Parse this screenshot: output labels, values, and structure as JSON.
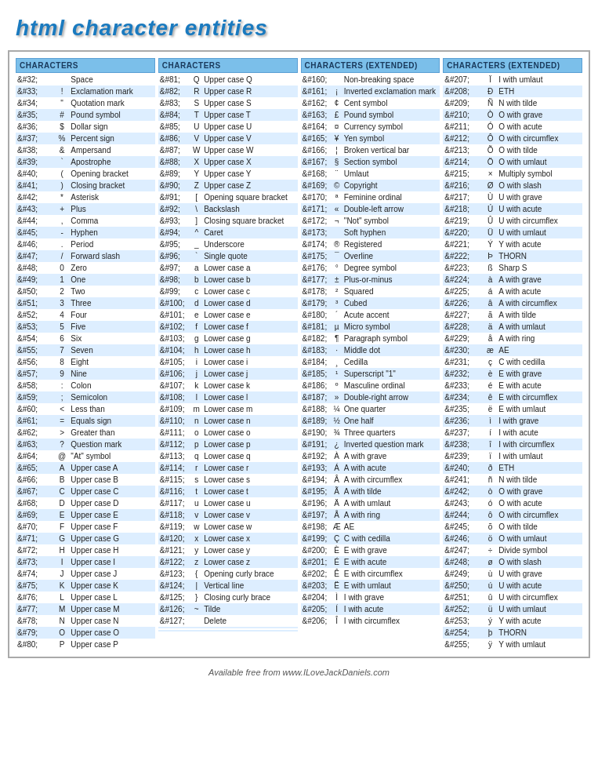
{
  "title": "html character entities",
  "footer": "Available free from www.ILoveJackDaniels.com",
  "columns": [
    {
      "header": "CHARACTERS",
      "rows": [
        [
          "&#32;",
          " ",
          "Space"
        ],
        [
          "&#33;",
          "!",
          "Exclamation mark"
        ],
        [
          "&#34;",
          "\"",
          "Quotation mark"
        ],
        [
          "&#35;",
          "#",
          "Pound symbol"
        ],
        [
          "&#36;",
          "$",
          "Dollar sign"
        ],
        [
          "&#37;",
          "%",
          "Percent sign"
        ],
        [
          "&#38;",
          "&",
          "Ampersand"
        ],
        [
          "&#39;",
          "`",
          "Apostrophe"
        ],
        [
          "&#40;",
          "(",
          "Opening bracket"
        ],
        [
          "&#41;",
          ")",
          "Closing bracket"
        ],
        [
          "&#42;",
          "*",
          "Asterisk"
        ],
        [
          "&#43;",
          "+",
          "Plus"
        ],
        [
          "&#44;",
          ",",
          "Comma"
        ],
        [
          "&#45;",
          "-",
          "Hyphen"
        ],
        [
          "&#46;",
          ".",
          "Period"
        ],
        [
          "&#47;",
          "/",
          "Forward slash"
        ],
        [
          "&#48;",
          "0",
          "Zero"
        ],
        [
          "&#49;",
          "1",
          "One"
        ],
        [
          "&#50;",
          "2",
          "Two"
        ],
        [
          "&#51;",
          "3",
          "Three"
        ],
        [
          "&#52;",
          "4",
          "Four"
        ],
        [
          "&#53;",
          "5",
          "Five"
        ],
        [
          "&#54;",
          "6",
          "Six"
        ],
        [
          "&#55;",
          "7",
          "Seven"
        ],
        [
          "&#56;",
          "8",
          "Eight"
        ],
        [
          "&#57;",
          "9",
          "Nine"
        ],
        [
          "&#58;",
          ":",
          "Colon"
        ],
        [
          "&#59;",
          ";",
          "Semicolon"
        ],
        [
          "&#60;",
          "<",
          "Less than"
        ],
        [
          "&#61;",
          "=",
          "Equals sign"
        ],
        [
          "&#62;",
          ">",
          "Greater than"
        ],
        [
          "&#63;",
          "?",
          "Question mark"
        ],
        [
          "&#64;",
          "@",
          "\"At\" symbol"
        ],
        [
          "&#65;",
          "A",
          "Upper case A"
        ],
        [
          "&#66;",
          "B",
          "Upper case B"
        ],
        [
          "&#67;",
          "C",
          "Upper case C"
        ],
        [
          "&#68;",
          "D",
          "Upper case D"
        ],
        [
          "&#69;",
          "E",
          "Upper case E"
        ],
        [
          "&#70;",
          "F",
          "Upper case F"
        ],
        [
          "&#71;",
          "G",
          "Upper case G"
        ],
        [
          "&#72;",
          "H",
          "Upper case H"
        ],
        [
          "&#73;",
          "I",
          "Upper case I"
        ],
        [
          "&#74;",
          "J",
          "Upper case J"
        ],
        [
          "&#75;",
          "K",
          "Upper case K"
        ],
        [
          "&#76;",
          "L",
          "Upper case L"
        ],
        [
          "&#77;",
          "M",
          "Upper case M"
        ],
        [
          "&#78;",
          "N",
          "Upper case N"
        ],
        [
          "&#79;",
          "O",
          "Upper case O"
        ],
        [
          "&#80;",
          "P",
          "Upper case P"
        ]
      ]
    },
    {
      "header": "CHARACTERS",
      "rows": [
        [
          "&#81;",
          "Q",
          "Upper case Q"
        ],
        [
          "&#82;",
          "R",
          "Upper case R"
        ],
        [
          "&#83;",
          "S",
          "Upper case S"
        ],
        [
          "&#84;",
          "T",
          "Upper case T"
        ],
        [
          "&#85;",
          "U",
          "Upper case U"
        ],
        [
          "&#86;",
          "V",
          "Upper case V"
        ],
        [
          "&#87;",
          "W",
          "Upper case W"
        ],
        [
          "&#88;",
          "X",
          "Upper case X"
        ],
        [
          "&#89;",
          "Y",
          "Upper case Y"
        ],
        [
          "&#90;",
          "Z",
          "Upper case Z"
        ],
        [
          "&#91;",
          "[",
          "Opening square bracket"
        ],
        [
          "&#92;",
          "\\",
          "Backslash"
        ],
        [
          "&#93;",
          "]",
          "Closing square bracket"
        ],
        [
          "&#94;",
          "^",
          "Caret"
        ],
        [
          "&#95;",
          "_",
          "Underscore"
        ],
        [
          "&#96;",
          "`",
          "Single quote"
        ],
        [
          "&#97;",
          "a",
          "Lower case a"
        ],
        [
          "&#98;",
          "b",
          "Lower case b"
        ],
        [
          "&#99;",
          "c",
          "Lower case c"
        ],
        [
          "&#100;",
          "d",
          "Lower case d"
        ],
        [
          "&#101;",
          "e",
          "Lower case e"
        ],
        [
          "&#102;",
          "f",
          "Lower case f"
        ],
        [
          "&#103;",
          "g",
          "Lower case g"
        ],
        [
          "&#104;",
          "h",
          "Lower case h"
        ],
        [
          "&#105;",
          "i",
          "Lower case i"
        ],
        [
          "&#106;",
          "j",
          "Lower case j"
        ],
        [
          "&#107;",
          "k",
          "Lower case k"
        ],
        [
          "&#108;",
          "l",
          "Lower case l"
        ],
        [
          "&#109;",
          "m",
          "Lower case m"
        ],
        [
          "&#110;",
          "n",
          "Lower case n"
        ],
        [
          "&#111;",
          "o",
          "Lower case o"
        ],
        [
          "&#112;",
          "p",
          "Lower case p"
        ],
        [
          "&#113;",
          "q",
          "Lower case q"
        ],
        [
          "&#114;",
          "r",
          "Lower case r"
        ],
        [
          "&#115;",
          "s",
          "Lower case s"
        ],
        [
          "&#116;",
          "t",
          "Lower case t"
        ],
        [
          "&#117;",
          "u",
          "Lower case u"
        ],
        [
          "&#118;",
          "v",
          "Lower case v"
        ],
        [
          "&#119;",
          "w",
          "Lower case w"
        ],
        [
          "&#120;",
          "x",
          "Lower case x"
        ],
        [
          "&#121;",
          "y",
          "Lower case y"
        ],
        [
          "&#122;",
          "z",
          "Lower case z"
        ],
        [
          "&#123;",
          "{",
          "Opening curly brace"
        ],
        [
          "&#124;",
          "|",
          "Vertical line"
        ],
        [
          "&#125;",
          "}",
          "Closing curly brace"
        ],
        [
          "&#126;",
          "~",
          "Tilde"
        ],
        [
          "&#127;",
          "",
          "Delete"
        ],
        [
          "",
          "",
          ""
        ],
        [
          "",
          "",
          ""
        ],
        [
          "",
          "",
          ""
        ]
      ]
    },
    {
      "header": "CHARACTERS (EXTENDED)",
      "rows": [
        [
          "&#160;",
          "",
          "Non-breaking space"
        ],
        [
          "&#161;",
          "¡",
          "Inverted exclamation mark"
        ],
        [
          "&#162;",
          "¢",
          "Cent symbol"
        ],
        [
          "&#163;",
          "£",
          "Pound symbol"
        ],
        [
          "&#164;",
          "¤",
          "Currency symbol"
        ],
        [
          "&#165;",
          "¥",
          "Yen symbol"
        ],
        [
          "&#166;",
          "¦",
          "Broken vertical bar"
        ],
        [
          "&#167;",
          "§",
          "Section symbol"
        ],
        [
          "&#168;",
          "¨",
          "Umlaut"
        ],
        [
          "&#169;",
          "©",
          "Copyright"
        ],
        [
          "&#170;",
          "ª",
          "Feminine ordinal"
        ],
        [
          "&#171;",
          "«",
          "Double-left arrow"
        ],
        [
          "&#172;",
          "¬",
          "\"Not\" symbol"
        ],
        [
          "&#173;",
          "",
          "Soft hyphen"
        ],
        [
          "&#174;",
          "®",
          "Registered"
        ],
        [
          "&#175;",
          "¯",
          "Overline"
        ],
        [
          "&#176;",
          "°",
          "Degree symbol"
        ],
        [
          "&#177;",
          "±",
          "Plus-or-minus"
        ],
        [
          "&#178;",
          "²",
          "Squared"
        ],
        [
          "&#179;",
          "³",
          "Cubed"
        ],
        [
          "&#180;",
          "´",
          "Acute accent"
        ],
        [
          "&#181;",
          "µ",
          "Micro symbol"
        ],
        [
          "&#182;",
          "¶",
          "Paragraph symbol"
        ],
        [
          "&#183;",
          "·",
          "Middle dot"
        ],
        [
          "&#184;",
          "¸",
          "Cedilla"
        ],
        [
          "&#185;",
          "¹",
          "Superscript \"1\""
        ],
        [
          "&#186;",
          "º",
          "Masculine ordinal"
        ],
        [
          "&#187;",
          "»",
          "Double-right arrow"
        ],
        [
          "&#188;",
          "¼",
          "One quarter"
        ],
        [
          "&#189;",
          "½",
          "One half"
        ],
        [
          "&#190;",
          "¾",
          "Three quarters"
        ],
        [
          "&#191;",
          "¿",
          "Inverted question mark"
        ],
        [
          "&#192;",
          "À",
          "A with grave"
        ],
        [
          "&#193;",
          "Á",
          "A with acute"
        ],
        [
          "&#194;",
          "Â",
          "A with circumflex"
        ],
        [
          "&#195;",
          "Ã",
          "A with tilde"
        ],
        [
          "&#196;",
          "Ä",
          "A with umlaut"
        ],
        [
          "&#197;",
          "Å",
          "A with ring"
        ],
        [
          "&#198;",
          "Æ",
          "AE"
        ],
        [
          "&#199;",
          "Ç",
          "C with cedilla"
        ],
        [
          "&#200;",
          "È",
          "E with grave"
        ],
        [
          "&#201;",
          "É",
          "E with acute"
        ],
        [
          "&#202;",
          "Ê",
          "E with circumflex"
        ],
        [
          "&#203;",
          "Ë",
          "E with umlaut"
        ],
        [
          "&#204;",
          "Ì",
          "I with grave"
        ],
        [
          "&#205;",
          "Í",
          "I with acute"
        ],
        [
          "&#206;",
          "Î",
          "I with circumflex"
        ]
      ]
    },
    {
      "header": "CHARACTERS (EXTENDED)",
      "rows": [
        [
          "&#207;",
          "Ï",
          "I with umlaut"
        ],
        [
          "&#208;",
          "Ð",
          "ETH"
        ],
        [
          "&#209;",
          "Ñ",
          "N with tilde"
        ],
        [
          "&#210;",
          "Ò",
          "O with grave"
        ],
        [
          "&#211;",
          "Ó",
          "O with acute"
        ],
        [
          "&#212;",
          "Ô",
          "O with circumflex"
        ],
        [
          "&#213;",
          "Õ",
          "O with tilde"
        ],
        [
          "&#214;",
          "Ö",
          "O with umlaut"
        ],
        [
          "&#215;",
          "×",
          "Multiply symbol"
        ],
        [
          "&#216;",
          "Ø",
          "O with slash"
        ],
        [
          "&#217;",
          "Ù",
          "U with grave"
        ],
        [
          "&#218;",
          "Ú",
          "U with acute"
        ],
        [
          "&#219;",
          "Û",
          "U with circumflex"
        ],
        [
          "&#220;",
          "Ü",
          "U with umlaut"
        ],
        [
          "&#221;",
          "Ý",
          "Y with acute"
        ],
        [
          "&#222;",
          "Þ",
          "THORN"
        ],
        [
          "&#223;",
          "ß",
          "Sharp S"
        ],
        [
          "&#224;",
          "à",
          "A with grave"
        ],
        [
          "&#225;",
          "á",
          "A with acute"
        ],
        [
          "&#226;",
          "â",
          "A with circumflex"
        ],
        [
          "&#227;",
          "ã",
          "A with tilde"
        ],
        [
          "&#228;",
          "ä",
          "A with umlaut"
        ],
        [
          "&#229;",
          "å",
          "A with ring"
        ],
        [
          "&#230;",
          "æ",
          "AE"
        ],
        [
          "&#231;",
          "ç",
          "C with cedilla"
        ],
        [
          "&#232;",
          "è",
          "E with grave"
        ],
        [
          "&#233;",
          "é",
          "E with acute"
        ],
        [
          "&#234;",
          "ê",
          "E with circumflex"
        ],
        [
          "&#235;",
          "ë",
          "E with umlaut"
        ],
        [
          "&#236;",
          "ì",
          "I with grave"
        ],
        [
          "&#237;",
          "í",
          "I with acute"
        ],
        [
          "&#238;",
          "î",
          "I with circumflex"
        ],
        [
          "&#239;",
          "ï",
          "I with umlaut"
        ],
        [
          "&#240;",
          "ð",
          "ETH"
        ],
        [
          "&#241;",
          "ñ",
          "N with tilde"
        ],
        [
          "&#242;",
          "ò",
          "O with grave"
        ],
        [
          "&#243;",
          "ó",
          "O with acute"
        ],
        [
          "&#244;",
          "ô",
          "O with circumflex"
        ],
        [
          "&#245;",
          "õ",
          "O with tilde"
        ],
        [
          "&#246;",
          "ö",
          "O with umlaut"
        ],
        [
          "&#247;",
          "÷",
          "Divide symbol"
        ],
        [
          "&#248;",
          "ø",
          "O with slash"
        ],
        [
          "&#249;",
          "ù",
          "U with grave"
        ],
        [
          "&#250;",
          "ú",
          "U with acute"
        ],
        [
          "&#251;",
          "û",
          "U with circumflex"
        ],
        [
          "&#252;",
          "ü",
          "U with umlaut"
        ],
        [
          "&#253;",
          "ý",
          "Y with acute"
        ],
        [
          "&#254;",
          "þ",
          "THORN"
        ],
        [
          "&#255;",
          "ÿ",
          "Y with umlaut"
        ]
      ]
    }
  ]
}
